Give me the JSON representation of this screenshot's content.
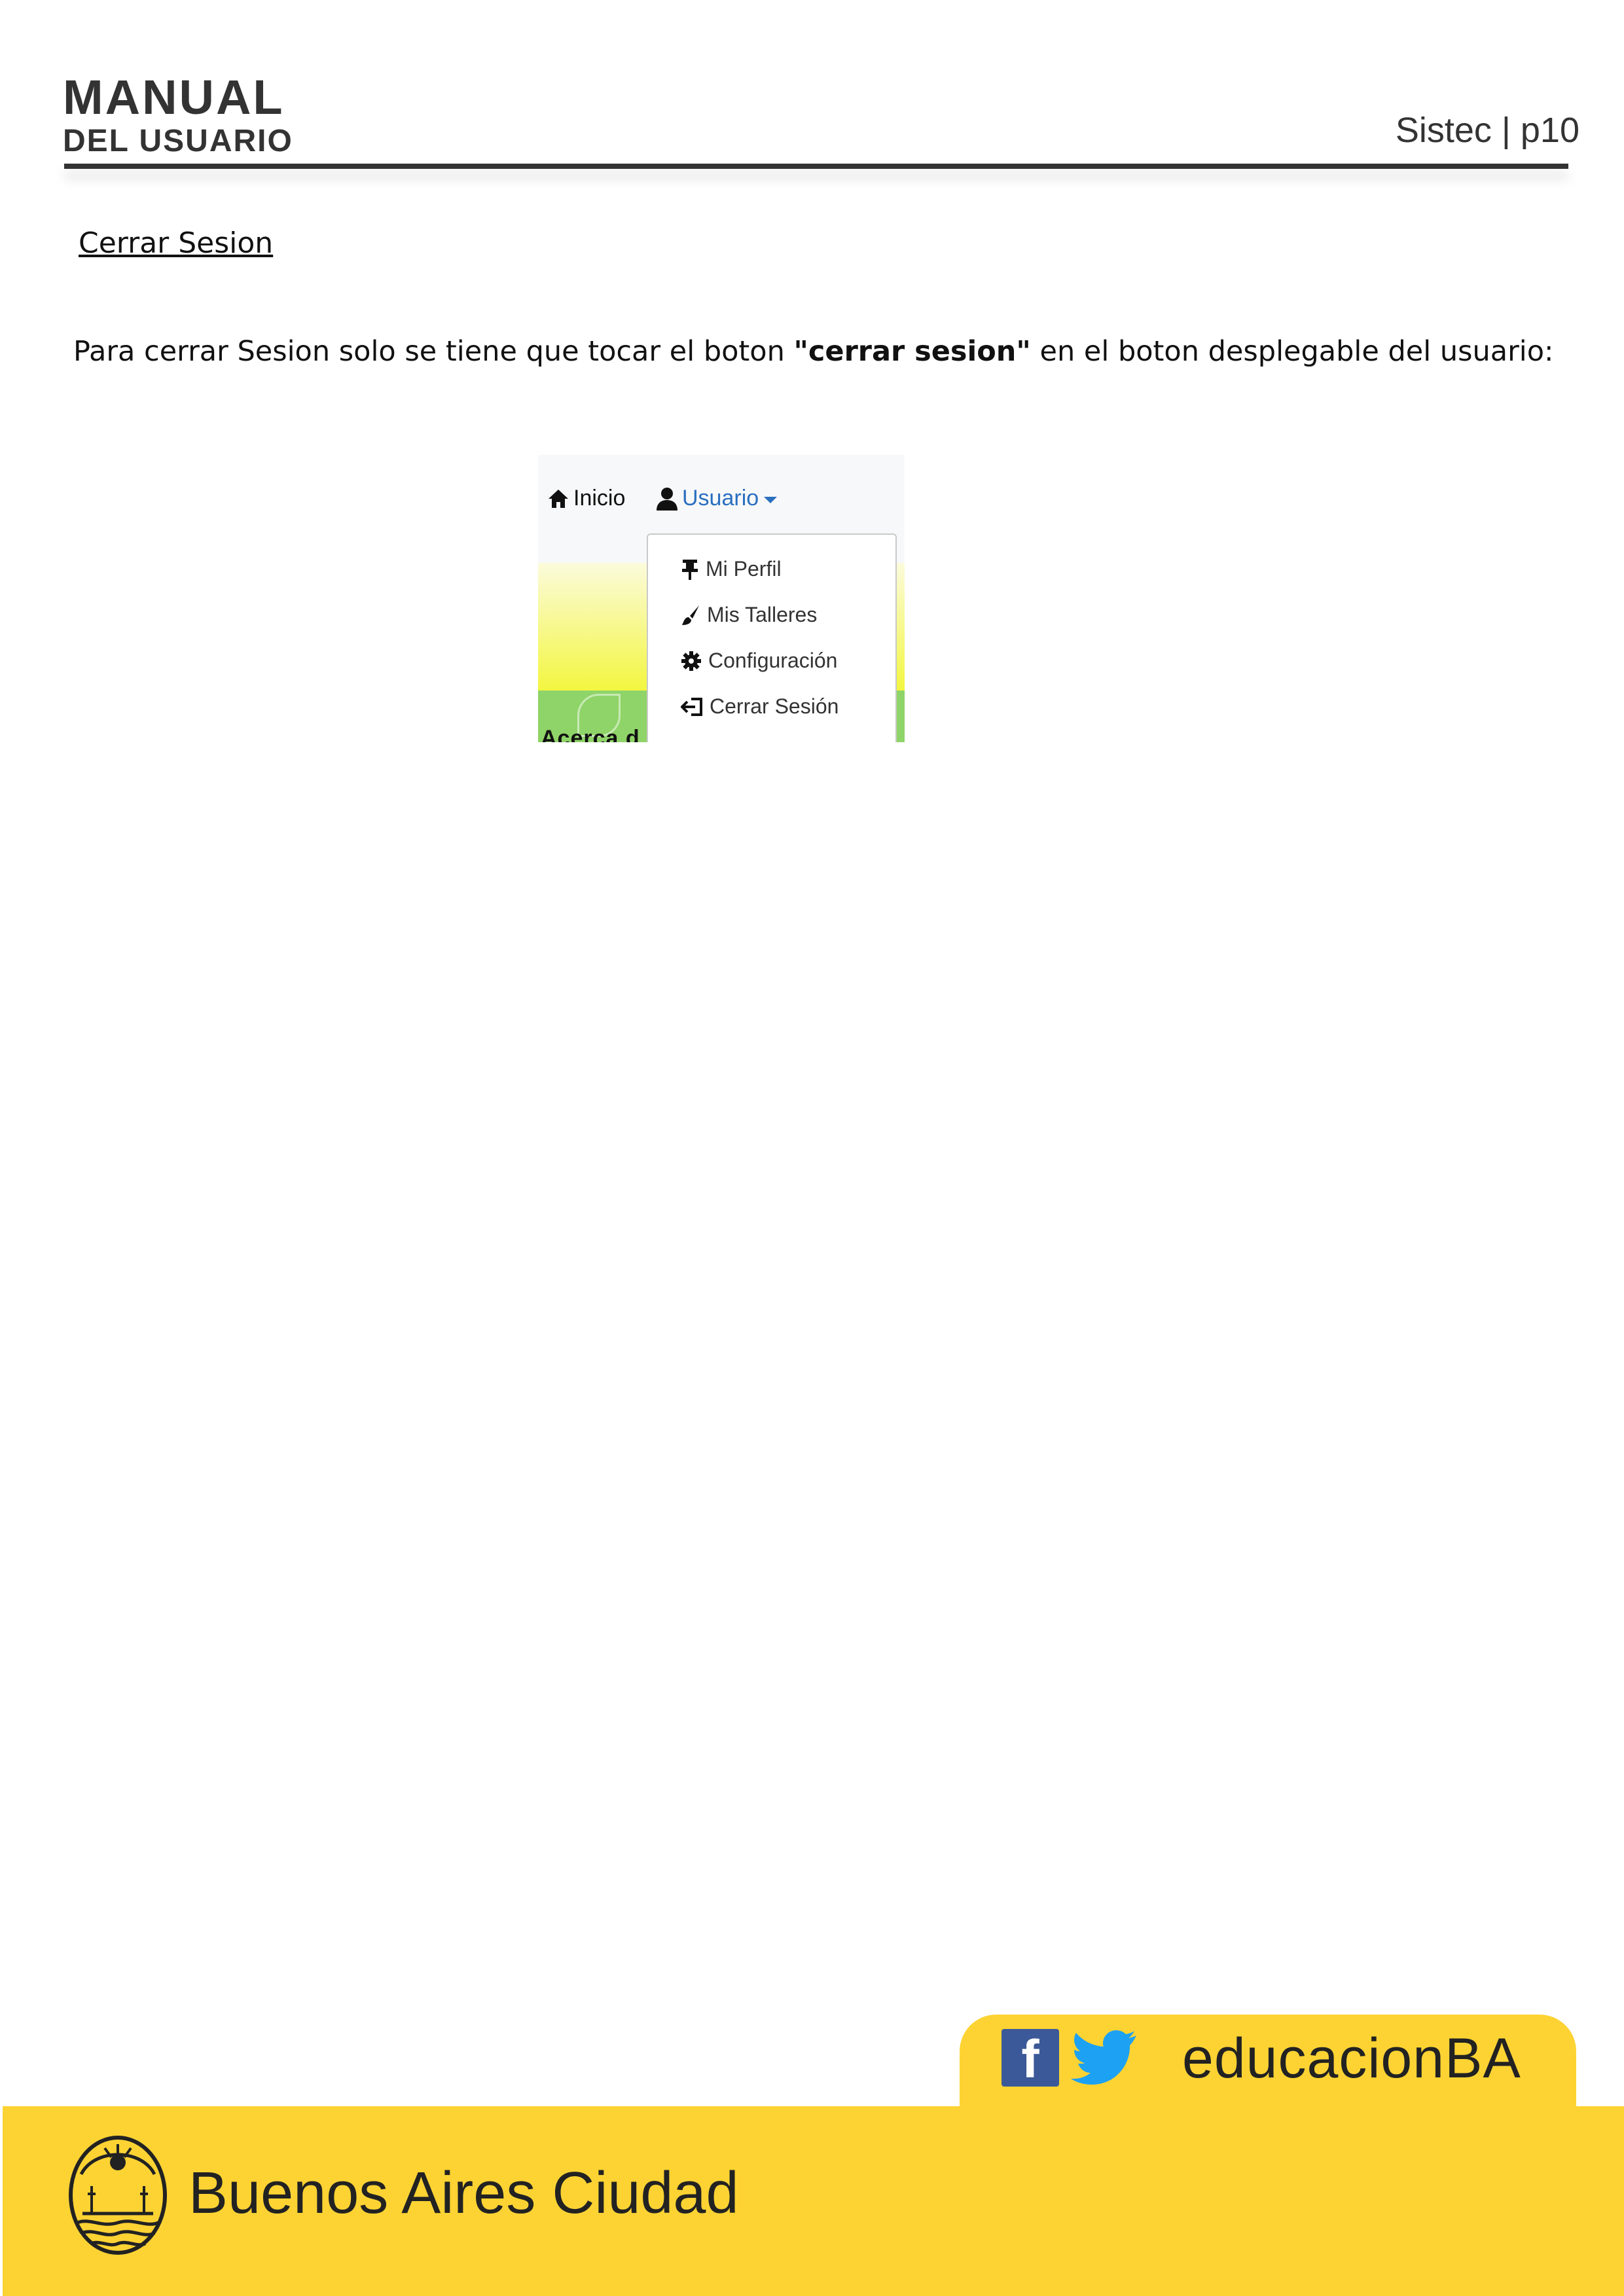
{
  "header": {
    "title_line1": "MANUAL",
    "title_line2": "DEL USUARIO",
    "page_label": "Sistec | p10"
  },
  "section": {
    "title": "Cerrar Sesion",
    "paragraph_before": "Para cerrar Sesion solo se tiene que tocar el boton ",
    "paragraph_bold": "\"cerrar sesion\"",
    "paragraph_after": " en el boton desplegable del usuario:"
  },
  "screenshot": {
    "nav_inicio": "Inicio",
    "nav_usuario": "Usuario",
    "link_color": "#2a6fc0",
    "dropdown_items": [
      {
        "label": "Mi Perfil",
        "icon": "pin-icon"
      },
      {
        "label": "Mis Talleres",
        "icon": "brush-icon"
      },
      {
        "label": "Configuración",
        "icon": "gear-icon"
      },
      {
        "label": "Cerrar Sesión",
        "icon": "sign-out-icon"
      }
    ],
    "background_text": "Acerca d"
  },
  "footer": {
    "social_handle": "educacionBA",
    "city_name": "Buenos Aires Ciudad",
    "brand_yellow": "#fdd333",
    "facebook_blue": "#3b5998",
    "twitter_blue": "#1da1f2"
  }
}
